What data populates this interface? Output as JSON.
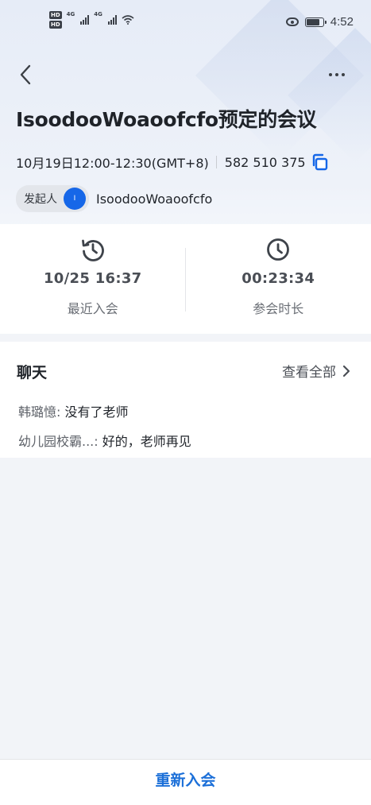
{
  "status_bar": {
    "network_left": [
      "HD",
      "HD"
    ],
    "network_type": "4G",
    "time": "4:52"
  },
  "nav": {
    "back_icon": "chevron-left-icon",
    "more_icon": "more-horizontal-icon"
  },
  "meeting": {
    "title": "IsoodooWoaoofcfo预定的会议",
    "time_range": "10月19日12:00-12:30(GMT+8)",
    "meeting_id": "582 510 375",
    "host_label": "发起人",
    "host_avatar_initial": "I",
    "host_name": "IsoodooWoaoofcfo"
  },
  "stats": [
    {
      "icon": "history-clock-icon",
      "value": "10/25 16:37",
      "label": "最近入会"
    },
    {
      "icon": "clock-icon",
      "value": "00:23:34",
      "label": "参会时长"
    }
  ],
  "chat": {
    "title": "聊天",
    "view_all_label": "查看全部",
    "messages": [
      {
        "sender": "韩璐憶:",
        "text": " 没有了老师"
      },
      {
        "sender": "幼儿园校霸...:",
        "text": " 好的，老师再见"
      }
    ]
  },
  "footer": {
    "rejoin_label": "重新入会"
  },
  "colors": {
    "accent": "#1667e8",
    "rejoin_text": "#1b6fd8",
    "background": "#f2f4f8"
  }
}
